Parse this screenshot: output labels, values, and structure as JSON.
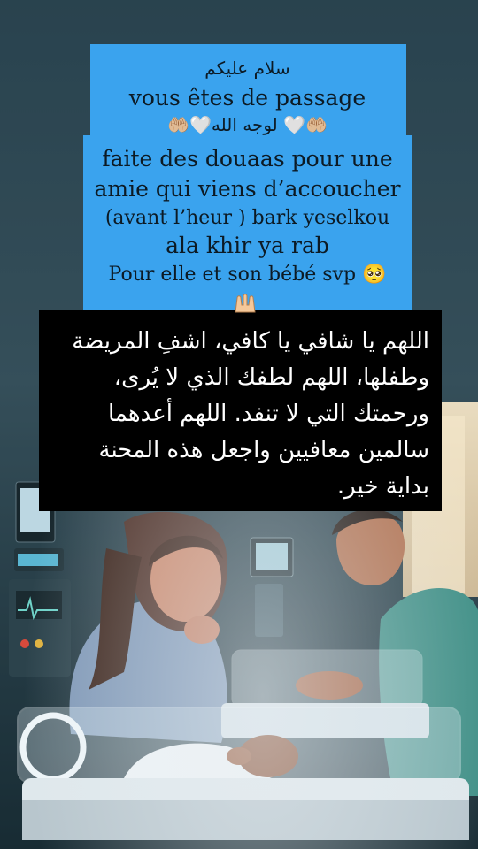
{
  "blue_card": {
    "greeting_ar": "سلام عليكم",
    "line_passing": "vous êtes de passage",
    "line_for_god": "🤲🏼🤍لوجه الله 🤍🤲🏼",
    "line_1": "faite des douaas pour une",
    "line_2": "amie qui viens d’accoucher",
    "line_3": "(avant l’heur ) bark yeselkou",
    "line_4": "ala khir ya rab",
    "line_5": "Pour elle et son bébé svp 🥺"
  },
  "dua": {
    "text": "اللهم يا شافي يا كافي، اشفِ المريضة وطفلها، اللهم لطفك الذي لا يُرى، ورحمتك التي لا تنفد. اللهم أعدهما سالمين معافيين واجعل هذه المحنة بداية خير."
  },
  "colors": {
    "card_blue": "#3aa3ee",
    "dua_background": "#000000",
    "dua_text": "#ffffff"
  },
  "icons": [
    "praying-hands-icon",
    "white-heart-icon",
    "pleading-face-icon"
  ]
}
